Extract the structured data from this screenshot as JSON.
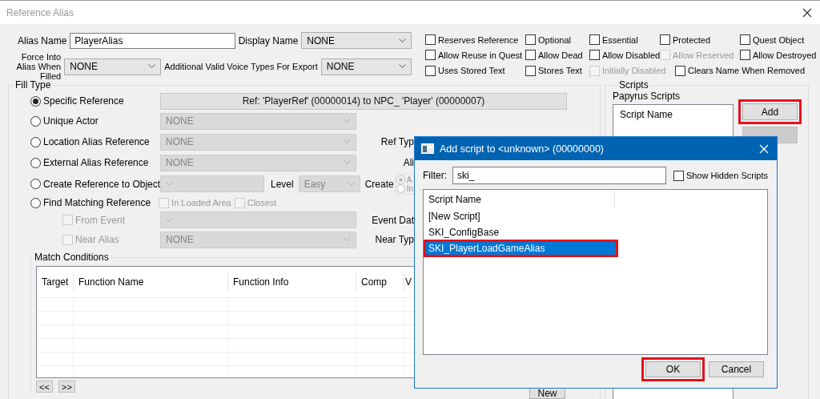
{
  "window": {
    "title": "Reference Alias"
  },
  "alias_name": {
    "label": "Alias Name",
    "value": "PlayerAlias"
  },
  "display_name": {
    "label": "Display Name",
    "value": "NONE"
  },
  "force_into_alias": {
    "label": "Force Into Alias When Filled",
    "value": "NONE"
  },
  "voice_types": {
    "label": "Additional Valid Voice Types For Export",
    "value": "NONE"
  },
  "flags": [
    [
      {
        "label": "Reserves Reference",
        "checked": false,
        "disabled": false
      },
      {
        "label": "Optional",
        "checked": false,
        "disabled": false
      },
      {
        "label": "Essential",
        "checked": false,
        "disabled": false
      },
      {
        "label": "Protected",
        "checked": false,
        "disabled": false
      },
      {
        "label": "Quest Object",
        "checked": false,
        "disabled": false
      }
    ],
    [
      {
        "label": "Allow Reuse in Quest",
        "checked": false,
        "disabled": false
      },
      {
        "label": "Allow Dead",
        "checked": false,
        "disabled": false
      },
      {
        "label": "Allow Disabled",
        "checked": false,
        "disabled": false
      },
      {
        "label": "Allow Reserved",
        "checked": false,
        "disabled": true
      },
      {
        "label": "Allow Destroyed",
        "checked": false,
        "disabled": false
      }
    ],
    [
      {
        "label": "Uses Stored Text",
        "checked": false,
        "disabled": false
      },
      {
        "label": "Stores Text",
        "checked": false,
        "disabled": false
      },
      {
        "label": "Initially Disabled",
        "checked": false,
        "disabled": true
      },
      {
        "label": "Clears Name When Removed",
        "checked": false,
        "disabled": false
      }
    ]
  ],
  "fill_type": {
    "title": "Fill Type",
    "specific_reference": {
      "label": "Specific Reference",
      "selected": true,
      "value": "Ref: 'PlayerRef' (00000014) to NPC_ 'Player' (00000007)"
    },
    "unique_actor": {
      "label": "Unique Actor",
      "selected": false,
      "value": "NONE"
    },
    "location_alias": {
      "label": "Location Alias Reference",
      "selected": false,
      "value": "NONE",
      "side_label": "Ref Typ"
    },
    "external_alias": {
      "label": "External Alias Reference",
      "selected": false,
      "value": "NONE",
      "side_label": "Ali"
    },
    "create_reference": {
      "label": "Create Reference to Object",
      "selected": false,
      "difficulty_label": "Level",
      "difficulty": "Easy",
      "side_label": "Create",
      "options": [
        {
          "label": "A",
          "selected": true,
          "disabled": true
        },
        {
          "label": "In",
          "selected": false,
          "disabled": true
        }
      ]
    },
    "find_matching": {
      "label": "Find Matching Reference",
      "selected": false,
      "checks": [
        {
          "label": "In Loaded Area",
          "checked": false,
          "disabled": true
        },
        {
          "label": "Closest",
          "checked": false,
          "disabled": true
        }
      ]
    },
    "from_event": {
      "label": "From Event",
      "checked": false,
      "disabled": true,
      "side_label": "Event Dat"
    },
    "near_alias": {
      "label": "Near Alias",
      "checked": false,
      "disabled": true,
      "value": "NONE",
      "side_label": "Near Typ"
    }
  },
  "match_conditions": {
    "title": "Match Conditions",
    "columns": [
      "Target",
      "Function Name",
      "Function Info",
      "Comp",
      "V"
    ],
    "prev_button": "<<",
    "next_button": ">>",
    "new_button": "New"
  },
  "scripts": {
    "title": "Scripts",
    "subtitle": "Papyrus Scripts",
    "columns": [
      "Script Name"
    ],
    "add_button": {
      "label": "Add",
      "highlighted": true
    }
  },
  "dialog": {
    "title": "Add script to <unknown> (00000000)",
    "filter_label": "Filter:",
    "filter_value": "ski_",
    "show_hidden": {
      "label": "Show Hidden Scripts",
      "checked": false
    },
    "columns": [
      "Script Name"
    ],
    "rows": [
      {
        "name": "[New Script]",
        "selected": false,
        "highlighted": false
      },
      {
        "name": "SKI_ConfigBase",
        "selected": false,
        "highlighted": false
      },
      {
        "name": "SKI_PlayerLoadGameAlias",
        "selected": true,
        "highlighted": true
      }
    ],
    "buttons": [
      {
        "label": "OK",
        "highlighted": true
      },
      {
        "label": "Cancel",
        "highlighted": false
      }
    ]
  }
}
